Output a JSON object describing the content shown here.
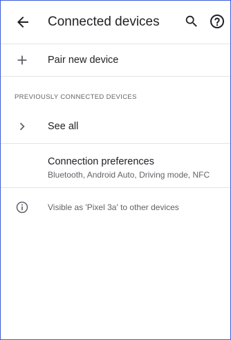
{
  "app_bar": {
    "title": "Connected devices",
    "back_icon": "arrow-back-icon",
    "search_icon": "search-icon",
    "help_icon": "help-icon"
  },
  "pair_new_device": {
    "label": "Pair new device",
    "icon": "plus-icon"
  },
  "previously_connected": {
    "header": "PREVIOUSLY CONNECTED DEVICES",
    "see_all_label": "See all",
    "see_all_icon": "chevron-right-icon"
  },
  "connection_preferences": {
    "title": "Connection preferences",
    "summary": "Bluetooth, Android Auto, Driving mode, NFC"
  },
  "footer_info": {
    "icon": "info-icon",
    "text": "Visible as 'Pixel 3a' to other devices"
  },
  "colors": {
    "text_primary": "#202124",
    "text_secondary": "#5f6368",
    "divider": "#e3e3e3",
    "frame_border": "#3b5bd6"
  }
}
